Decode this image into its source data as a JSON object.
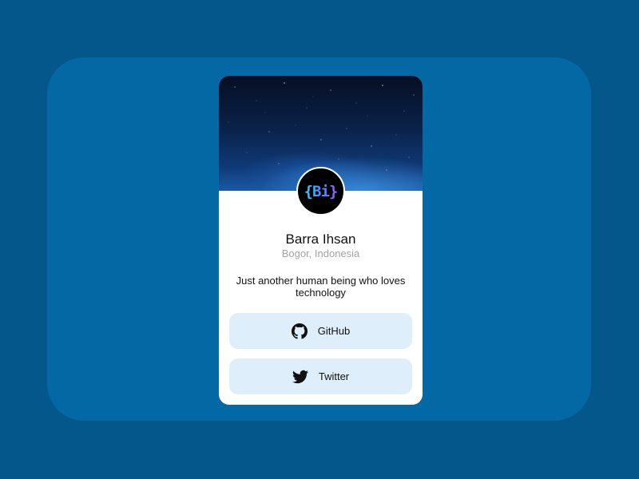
{
  "profile": {
    "name": "Barra Ihsan",
    "location": "Bogor, Indonesia",
    "bio": "Just another human being who loves technology",
    "avatar_text": "{Bi}",
    "avatar_icon": "code-brackets-logo"
  },
  "links": [
    {
      "label": "GitHub",
      "icon": "github-icon"
    },
    {
      "label": "Twitter",
      "icon": "twitter-icon"
    }
  ],
  "colors": {
    "background": "#03578a",
    "panel": "#0468a4",
    "card": "#ffffff",
    "button": "#deeffb",
    "secondary_text": "#a3a3a3"
  }
}
